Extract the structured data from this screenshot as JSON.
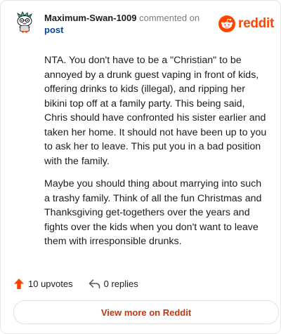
{
  "comment": {
    "author": "Maximum-Swan-1009",
    "commented_on_text": "commented on",
    "post_link_text": "post",
    "paragraphs": [
      "NTA. You don't have to be a \"Christian\" to be annoyed by a drunk guest vaping in front of kids, offering drinks to kids (illegal), and ripping her bikini top off at a family party. This being said, Chris should have confronted his sister earlier and taken her home. It should not have been up to you to ask her to leave. This put you in a bad position with the family.",
      "Maybe you should thing about marrying into such a trashy family. Think of all the fun Christmas and Thanksgiving get-togethers over the years and fights over the kids when you don't want to leave them with irresponsible drunks."
    ]
  },
  "brand": {
    "wordmark": "reddit",
    "color": "#ff4500",
    "icon": "reddit-snoo-icon"
  },
  "stats": {
    "upvotes_label": "10 upvotes",
    "replies_label": "0 replies",
    "upvote_icon": "upvote-arrow-icon",
    "reply_icon": "reply-arrow-icon",
    "upvote_color": "#ff4500"
  },
  "footer": {
    "view_more_label": "View more on Reddit",
    "view_more_color": "#c4360e"
  },
  "avatar": {
    "icon": "snoo-avatar-icon"
  }
}
